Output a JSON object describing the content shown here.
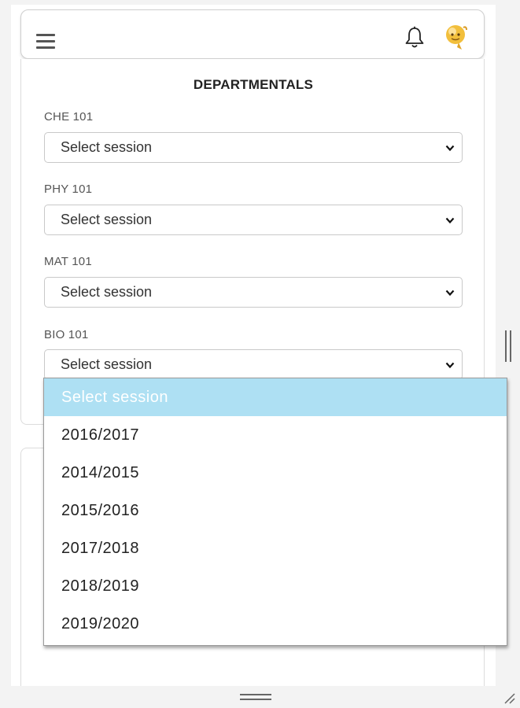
{
  "header": {
    "menu_icon": "hamburger-menu-icon",
    "notification_icon": "bell-icon",
    "avatar_icon": "user-avatar"
  },
  "section": {
    "title": "DEPARTMENTALS"
  },
  "courses": [
    {
      "code": "CHE 101",
      "selected": "Select session"
    },
    {
      "code": "PHY 101",
      "selected": "Select session"
    },
    {
      "code": "MAT 101",
      "selected": "Select session"
    },
    {
      "code": "BIO 101",
      "selected": "Select session"
    }
  ],
  "dropdown": {
    "highlighted": "Select session",
    "options": [
      "Select session",
      "2016/2017",
      "2014/2015",
      "2015/2016",
      "2017/2018",
      "2018/2019",
      "2019/2020"
    ]
  },
  "colors": {
    "highlight": "#aee0f3",
    "border": "#c9c9c9"
  }
}
